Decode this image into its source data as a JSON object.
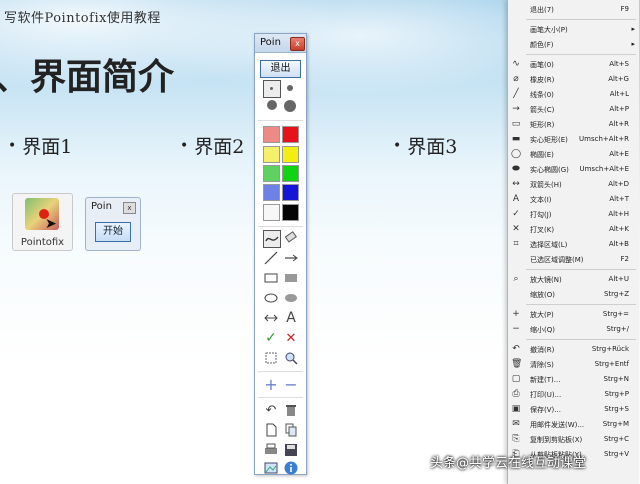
{
  "slide": {
    "header": "写软件Pointofix使用教程",
    "title": "、界面简介",
    "bullets": [
      "界面1",
      "界面2",
      "界面3"
    ],
    "app_icon_label": "Pointofix",
    "mini_window": {
      "title": "Poin",
      "close": "x",
      "start_button": "开始"
    }
  },
  "toolbar": {
    "title": "Poin",
    "close": "x",
    "exit_label": "退出",
    "colors": [
      "#ee8a86",
      "#e8131a",
      "#f4f06c",
      "#f2ee12",
      "#5fd160",
      "#0fd40f",
      "#6f80e6",
      "#1515d8",
      "#f7f7f7",
      "#050505"
    ],
    "tool_icons": [
      "freehand-icon",
      "eraser-icon",
      "line-icon",
      "arrow-icon",
      "rectangle-icon",
      "filled-rectangle-icon",
      "ellipse-icon",
      "filled-ellipse-icon",
      "double-arrow-icon",
      "text-icon",
      "check-icon",
      "cross-icon",
      "select-area-icon",
      "magnifier-icon",
      "zoom-in-icon",
      "zoom-out-icon",
      "undo-icon",
      "trash-icon",
      "new-icon",
      "copy-icon",
      "print-icon",
      "save-icon",
      "screenshot-icon",
      "info-icon"
    ]
  },
  "menu": {
    "items": [
      {
        "icon": "",
        "label": "退出(7)",
        "shortcut": "F9"
      },
      {
        "sep": true
      },
      {
        "icon": "",
        "label": "画笔大小(P)",
        "shortcut": "",
        "arrow": "▸"
      },
      {
        "icon": "",
        "label": "颜色(F)",
        "shortcut": "",
        "arrow": "▸"
      },
      {
        "sep": true
      },
      {
        "icon": "∿",
        "label": "画笔(0)",
        "shortcut": "Alt+S"
      },
      {
        "icon": "⌀",
        "label": "橡皮(R)",
        "shortcut": "Alt+G"
      },
      {
        "icon": "╱",
        "label": "线条(0)",
        "shortcut": "Alt+L"
      },
      {
        "icon": "→",
        "label": "箭头(C)",
        "shortcut": "Alt+P"
      },
      {
        "icon": "▭",
        "label": "矩形(R)",
        "shortcut": "Alt+R"
      },
      {
        "icon": "▬",
        "label": "实心矩形(E)",
        "shortcut": "Umsch+Alt+R"
      },
      {
        "icon": "◯",
        "label": "椭圆(E)",
        "shortcut": "Alt+E"
      },
      {
        "icon": "⬬",
        "label": "实心椭圆(G)",
        "shortcut": "Umsch+Alt+E"
      },
      {
        "icon": "↔",
        "label": "双箭头(H)",
        "shortcut": "Alt+D"
      },
      {
        "icon": "A",
        "label": "文本(I)",
        "shortcut": "Alt+T"
      },
      {
        "icon": "✓",
        "label": "打勾(J)",
        "shortcut": "Alt+H"
      },
      {
        "icon": "✕",
        "label": "打叉(K)",
        "shortcut": "Alt+K"
      },
      {
        "icon": "⌗",
        "label": "选择区域(L)",
        "shortcut": "Alt+B"
      },
      {
        "icon": "",
        "label": "已选区域调整(M)",
        "shortcut": "F2"
      },
      {
        "sep": true
      },
      {
        "icon": "⌕",
        "label": "放大镜(N)",
        "shortcut": "Alt+U"
      },
      {
        "icon": "",
        "label": "缩放(O)",
        "shortcut": "Strg+Z"
      },
      {
        "sep": true
      },
      {
        "icon": "+",
        "label": "放大(P)",
        "shortcut": "Strg+="
      },
      {
        "icon": "−",
        "label": "缩小(Q)",
        "shortcut": "Strg+/"
      },
      {
        "sep": true
      },
      {
        "icon": "↶",
        "label": "撤消(R)",
        "shortcut": "Strg+Rück"
      },
      {
        "icon": "🗑",
        "label": "清除(S)",
        "shortcut": "Strg+Entf"
      },
      {
        "icon": "▢",
        "label": "新建(T)...",
        "shortcut": "Strg+N"
      },
      {
        "icon": "⎙",
        "label": "打印(U)...",
        "shortcut": "Strg+P"
      },
      {
        "icon": "▣",
        "label": "保存(V)...",
        "shortcut": "Strg+S"
      },
      {
        "icon": "✉",
        "label": "用邮件发送(W)...",
        "shortcut": "Strg+M"
      },
      {
        "icon": "⎘",
        "label": "复制到剪贴板(X)",
        "shortcut": "Strg+C"
      },
      {
        "icon": "⎗",
        "label": "从剪贴板粘贴(Y)",
        "shortcut": "Strg+V"
      }
    ]
  },
  "watermark": "头条@共学云在线互动课堂"
}
